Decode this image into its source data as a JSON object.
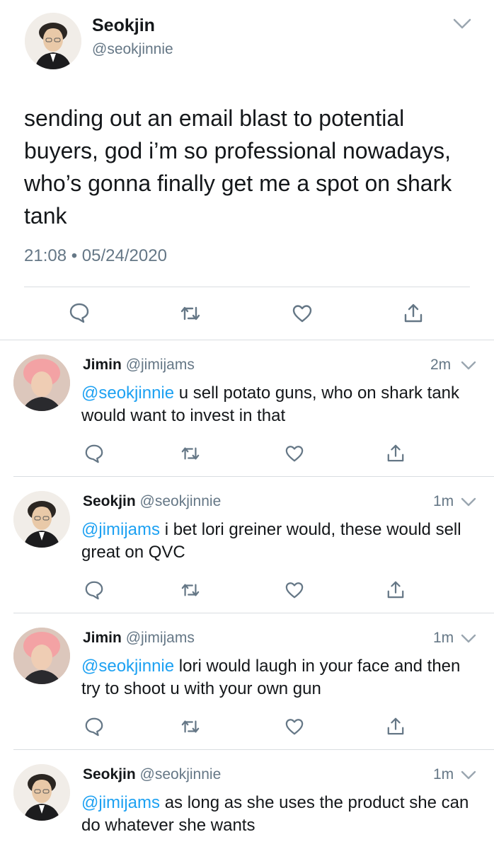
{
  "main_tweet": {
    "display_name": "Seokjin",
    "handle": "@seokjinnie",
    "text": "sending out an email blast to potential buyers, god i’m so professional nowadays, who’s gonna finally get me a spot on shark tank",
    "timestamp": "21:08 • 05/24/2020"
  },
  "replies": [
    {
      "display_name": "Jimin",
      "handle": "@jimijams",
      "time": "2m",
      "mention": "@seokjinnie",
      "text": " u sell potato guns, who on shark tank would want to invest in that"
    },
    {
      "display_name": "Seokjin",
      "handle": "@seokjinnie",
      "time": "1m",
      "mention": "@jimijams",
      "text": " i bet lori greiner would, these would sell great on QVC"
    },
    {
      "display_name": "Jimin",
      "handle": "@jimijams",
      "time": "1m",
      "mention": "@seokjinnie",
      "text": " lori would laugh in your face and then try to shoot u with your own gun"
    },
    {
      "display_name": "Seokjin",
      "handle": "@seokjinnie",
      "time": "1m",
      "mention": "@jimijams",
      "text": " as long as she uses the product she can do whatever she wants"
    }
  ],
  "colors": {
    "link": "#1da1f2",
    "muted": "#657786",
    "icon": "#657786",
    "jimin_hair": "#f3a2a4",
    "seokjin_hair": "#2b2622"
  },
  "icons": [
    "chevron-down-icon",
    "reply-icon",
    "retweet-icon",
    "like-icon",
    "share-icon"
  ]
}
